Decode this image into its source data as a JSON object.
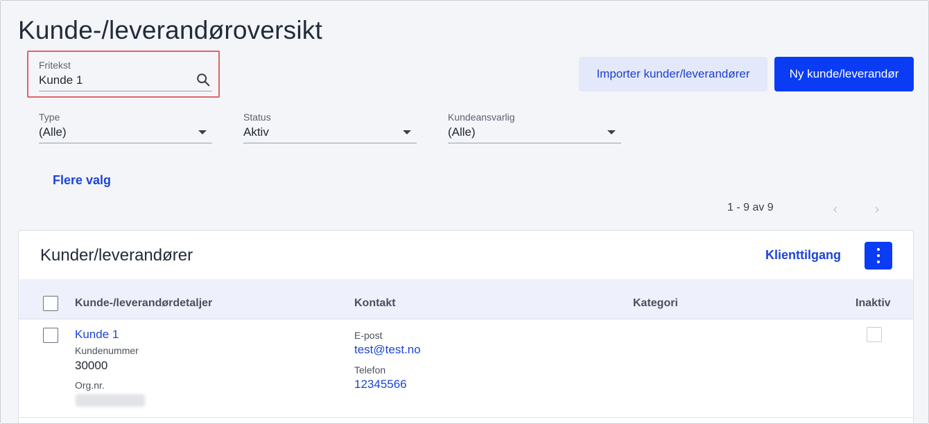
{
  "page": {
    "title": "Kunde-/leverandøroversikt"
  },
  "search": {
    "label": "Fritekst",
    "value": "Kunde 1",
    "icon": "search-icon"
  },
  "actions": {
    "import_label": "Importer kunder/leverandører",
    "new_label": "Ny kunde/leverandør"
  },
  "filters": [
    {
      "label": "Type",
      "value": "(Alle)"
    },
    {
      "label": "Status",
      "value": "Aktiv"
    },
    {
      "label": "Kundeansvarlig",
      "value": "(Alle)"
    }
  ],
  "more_options": "Flere valg",
  "pagination": {
    "text": "1 - 9 av 9",
    "prev": "‹",
    "next": "›"
  },
  "card": {
    "title": "Kunder/leverandører",
    "client_access": "Klienttilgang",
    "columns": [
      "Kunde-/leverandørdetaljer",
      "Kontakt",
      "Kategori",
      "Inaktiv"
    ],
    "rows": [
      {
        "name": "Kunde 1",
        "customer_number_label": "Kundenummer",
        "customer_number": "30000",
        "org_label": "Org.nr.",
        "email_label": "E-post",
        "email": "test@test.no",
        "phone_label": "Telefon",
        "phone": "12345566",
        "inactive": false
      }
    ]
  },
  "colors": {
    "primary": "#0a3cf5",
    "link": "#1c44d6",
    "highlight": "#e0636b"
  }
}
